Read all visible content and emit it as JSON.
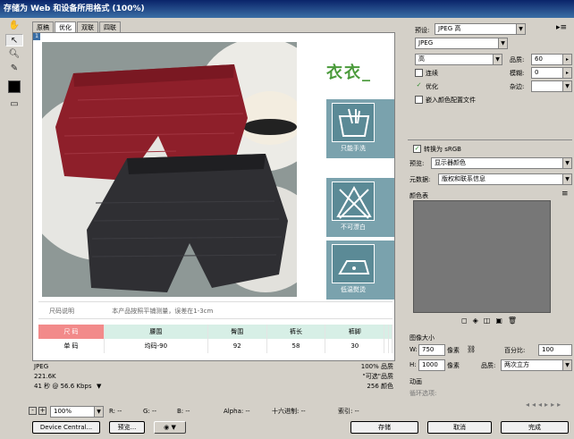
{
  "window": {
    "title": "存储为 Web 和设备所用格式 (100%)"
  },
  "tabs": [
    {
      "label": "原稿"
    },
    {
      "label": "优化"
    },
    {
      "label": "双联"
    },
    {
      "label": "四联"
    }
  ],
  "care_labels": {
    "brand": "衣衣_",
    "items": [
      {
        "label": "只能手洗"
      },
      {
        "label": "不可漂白"
      },
      {
        "label": "低温熨烫"
      }
    ]
  },
  "product": {
    "notes_header": "尺码说明",
    "notes_text": "本产品按照平铺测量，误差在1-3cm",
    "table": {
      "headers": [
        "尺 码",
        "腰围",
        "臀围",
        "裤长",
        "裤脚"
      ],
      "rows": [
        [
          "单 码",
          "均码-90",
          "92",
          "58",
          "30"
        ]
      ]
    }
  },
  "status": {
    "format": "JPEG",
    "size": "221.6K",
    "time": "41 秒 @ 56.6 Kbps",
    "quality_line": "100% 品质",
    "dither_line": "\"可选\"品质",
    "colors_line": "256 颜色"
  },
  "bottom": {
    "zoom": "100%",
    "r": "R: --",
    "g": "G: --",
    "b": "B: --",
    "alpha": "Alpha: --",
    "hex": "十六进制: --",
    "index": "索引: --"
  },
  "buttons": {
    "device_central": "Device Central...",
    "preview": "预览...",
    "save": "存储",
    "cancel": "取消",
    "done": "完成"
  },
  "right": {
    "preset_label": "预设:",
    "preset_value": "JPEG 高",
    "format_value": "JPEG",
    "compression_value": "高",
    "quality_label": "品质:",
    "quality_value": "60",
    "progressive_label": "连续",
    "blur_label": "模糊:",
    "blur_value": "0",
    "optimized_label": "优化",
    "matte_label": "杂边:",
    "embed_profile_label": "嵌入颜色配置文件",
    "convert_srgb_label": "转换为 sRGB",
    "preview_label": "预览:",
    "preview_value": "显示器颜色",
    "metadata_label": "元数据:",
    "metadata_value": "版权和联系信息",
    "colortable_label": "颜色表",
    "imagesize_label": "图像大小",
    "w_label": "W:",
    "w_value": "750",
    "h_label": "H:",
    "h_value": "1000",
    "px": "像素",
    "percent_label": "百分比:",
    "percent_value": "100",
    "quality2_label": "品质:",
    "quality2_value": "两次立方",
    "animation_label": "动画",
    "loop_label": "循环选项:"
  }
}
